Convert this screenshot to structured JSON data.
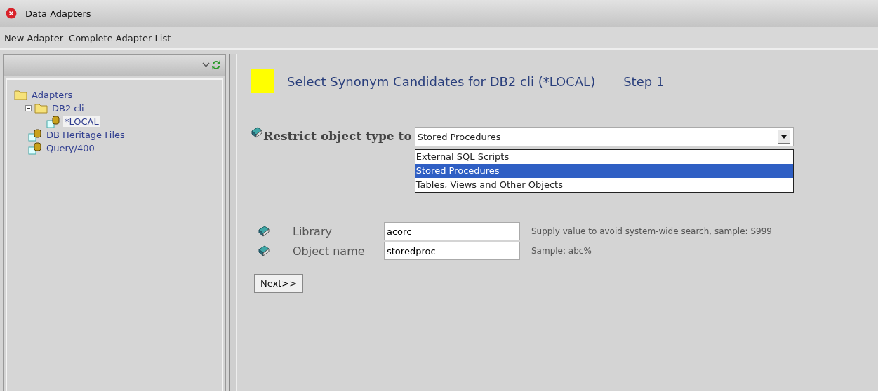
{
  "window": {
    "title": "Data Adapters"
  },
  "menu": [
    "New Adapter",
    "Complete Adapter List"
  ],
  "tree": [
    {
      "label": "Adapters",
      "kind": "folder",
      "selected": false,
      "children": [
        {
          "label": "DB2 cli",
          "kind": "folder",
          "expanded": true,
          "selected": false,
          "children": [
            {
              "label": "*LOCAL",
              "kind": "adapter",
              "selected": true
            }
          ]
        },
        {
          "label": "DB Heritage Files",
          "kind": "adapter",
          "selected": false
        },
        {
          "label": "Query/400",
          "kind": "adapter",
          "selected": false
        }
      ]
    }
  ],
  "heading": {
    "title": "Select Synonym Candidates for DB2 cli (*LOCAL)",
    "step": "Step 1"
  },
  "restrict": {
    "label": "Restrict object type to",
    "value": "Stored Procedures",
    "options": [
      {
        "label": "External SQL Scripts",
        "selected": false
      },
      {
        "label": "Stored Procedures",
        "selected": true
      },
      {
        "label": "Tables, Views and Other Objects",
        "selected": false
      }
    ]
  },
  "fields": [
    {
      "label": "Library",
      "value": "acorc",
      "hint": "Supply value to avoid system-wide search, sample: S999"
    },
    {
      "label": "Object name",
      "value": "storedproc",
      "hint": "Sample: abc%"
    }
  ],
  "next_button": "Next>>"
}
